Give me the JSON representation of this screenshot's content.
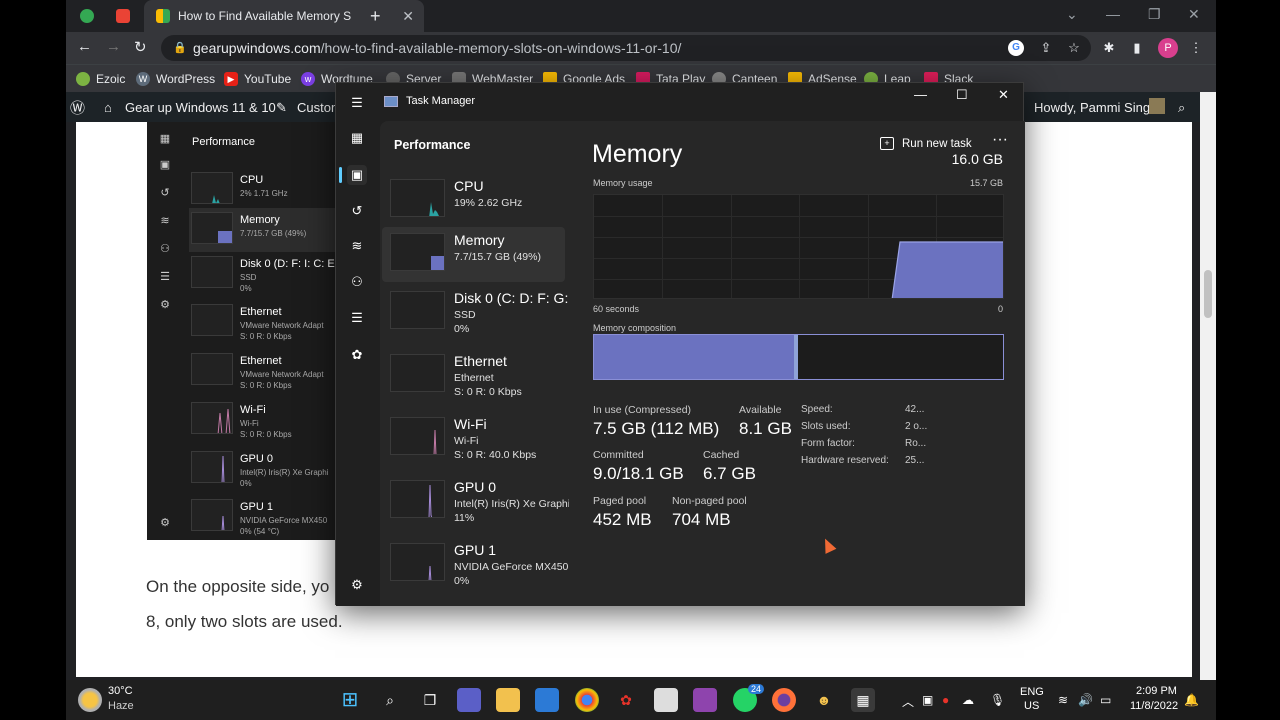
{
  "browser": {
    "active_tab_title": "How to Find Available Memory S",
    "url_host": "gearupwindows.com",
    "url_path": "/how-to-find-available-memory-slots-on-windows-11-or-10/",
    "profile_initial": "P",
    "bookmarks": [
      "Ezoic",
      "WordPress",
      "YouTube",
      "Wordtune",
      "Server",
      "WebMaster",
      "Google Ads",
      "Tata Play",
      "Canteen",
      "AdSense",
      "Leap",
      "Slack"
    ]
  },
  "wp_admin_bar": {
    "site_name": "Gear up Windows 11 & 10",
    "customize": "Custom",
    "howdy": "Howdy, Pammi Singh"
  },
  "article": {
    "line1_visible": "On the opposite side, yo",
    "line2": "8, only two slots are used."
  },
  "embedded_screenshot": {
    "header": "Performance",
    "items": [
      {
        "title": "CPU",
        "sub1": "2% 1.71 GHz",
        "sub2": ""
      },
      {
        "title": "Memory",
        "sub1": "7.7/15.7 GB (49%)",
        "sub2": ""
      },
      {
        "title": "Disk 0 (D: F: I: C: E",
        "sub1": "SSD",
        "sub2": "0%"
      },
      {
        "title": "Ethernet",
        "sub1": "VMware Network Adapt",
        "sub2": "S: 0 R: 0 Kbps"
      },
      {
        "title": "Ethernet",
        "sub1": "VMware Network Adapt",
        "sub2": "S: 0 R: 0 Kbps"
      },
      {
        "title": "Wi-Fi",
        "sub1": "Wi-Fi",
        "sub2": "S: 0 R: 0 Kbps"
      },
      {
        "title": "GPU 0",
        "sub1": "Intel(R) Iris(R) Xe Graphi",
        "sub2": "0%"
      },
      {
        "title": "GPU 1",
        "sub1": "NVIDIA GeForce MX450",
        "sub2": "0% (54 °C)"
      }
    ]
  },
  "task_manager": {
    "window_title": "Task Manager",
    "page_header": "Performance",
    "run_new_task": "Run new task",
    "items": [
      {
        "title": "CPU",
        "sub1": "19% 2.62 GHz",
        "sub2": ""
      },
      {
        "title": "Memory",
        "sub1": "7.7/15.7 GB (49%)",
        "sub2": ""
      },
      {
        "title": "Disk 0 (C: D: F: G: I",
        "sub1": "SSD",
        "sub2": "0%"
      },
      {
        "title": "Ethernet",
        "sub1": "Ethernet",
        "sub2": "S: 0 R: 0 Kbps"
      },
      {
        "title": "Wi-Fi",
        "sub1": "Wi-Fi",
        "sub2": "S: 0 R: 40.0 Kbps"
      },
      {
        "title": "GPU 0",
        "sub1": "Intel(R) Iris(R) Xe Graphi",
        "sub2": "11%"
      },
      {
        "title": "GPU 1",
        "sub1": "NVIDIA GeForce MX450",
        "sub2": "0%"
      }
    ],
    "detail": {
      "title": "Memory",
      "total": "16.0 GB",
      "usage_label": "Memory usage",
      "usage_max": "15.7 GB",
      "graph_left": "60 seconds",
      "graph_right": "0",
      "composition_label": "Memory composition",
      "composition_used_fraction": 0.49,
      "in_use_label": "In use (Compressed)",
      "in_use_value": "7.5 GB (112 MB)",
      "available_label": "Available",
      "available_value": "8.1 GB",
      "committed_label": "Committed",
      "committed_value": "9.0/18.1 GB",
      "cached_label": "Cached",
      "cached_value": "6.7 GB",
      "paged_label": "Paged pool",
      "paged_value": "452 MB",
      "nonpaged_label": "Non-paged pool",
      "nonpaged_value": "704 MB",
      "specs": [
        {
          "label": "Speed:",
          "value": "42..."
        },
        {
          "label": "Slots used:",
          "value": "2 o..."
        },
        {
          "label": "Form factor:",
          "value": "Ro..."
        },
        {
          "label": "Hardware reserved:",
          "value": "25..."
        }
      ]
    }
  },
  "taskbar": {
    "weather_temp": "30°C",
    "weather_desc": "Haze",
    "whatsapp_badge": "24",
    "lang_top": "ENG",
    "lang_bottom": "US",
    "time": "2:09 PM",
    "date": "11/8/2022"
  },
  "colors": {
    "memory_accent": "#6b72c0",
    "cpu_accent": "#2aa3a3",
    "wifi_accent": "#c27aa6",
    "gpu_accent": "#a48ad6"
  }
}
